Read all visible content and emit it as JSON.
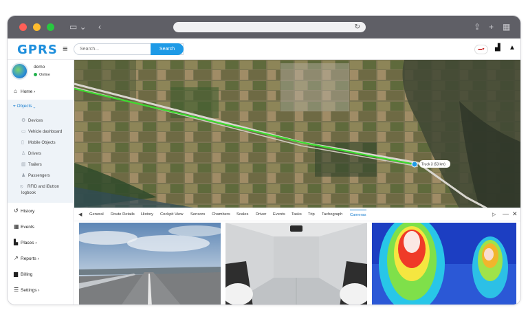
{
  "browser": {
    "traffic_lights": [
      "#ff5f57",
      "#febc2e",
      "#28c840"
    ],
    "reload_icon": "reload-icon"
  },
  "app": {
    "logo": "GPRS",
    "search_placeholder": "Search...",
    "search_button": "Search",
    "flag_label": "▬▾",
    "accent_color": "#1e9ae6"
  },
  "user": {
    "name": "demo",
    "status": "Online"
  },
  "nav": {
    "home": "Home",
    "objects": "Objects",
    "objects_sub": [
      "Devices",
      "Vehicle dashboard",
      "Mobile Objects",
      "Drivers",
      "Trailers",
      "Passengers",
      "RFID and iButton logbook"
    ],
    "history": "History",
    "events": "Events",
    "places": "Places",
    "reports": "Reports",
    "billing": "Billing",
    "settings": "Settings"
  },
  "map": {
    "marker_label": "Truck 3 (53 km)"
  },
  "panel": {
    "tabs": [
      "General",
      "Route Details",
      "History",
      "Cockpit View",
      "Sensors",
      "Chambers",
      "Scales",
      "Driver",
      "Events",
      "Tasks",
      "Trip",
      "Tachograph",
      "Cameras"
    ],
    "active_tab": "Cameras"
  }
}
